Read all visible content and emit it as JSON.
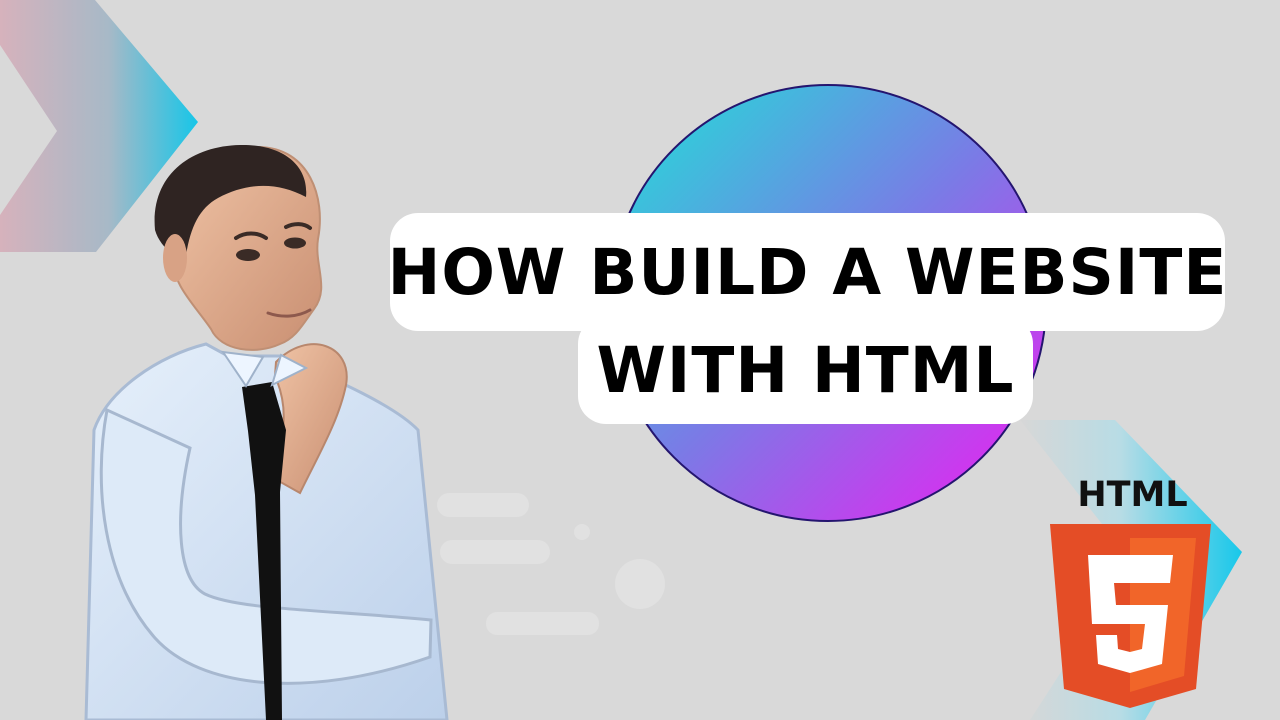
{
  "title": {
    "line1": "HOW BUILD A WEBSITE",
    "line2": "WITH HTML"
  },
  "logo": {
    "label": "HTML",
    "glyph": "5",
    "colors": {
      "outer": "#e44d26",
      "inner": "#f16529",
      "glyph": "#ffffff"
    }
  },
  "palette": {
    "background": "#d9d9d9",
    "circle_top": "#22e1d8",
    "circle_bottom": "#e11ef0",
    "arrow_start": "#d6a8b6",
    "arrow_end": "#18c8ea"
  },
  "decorations": {
    "person": "thinking-man-in-shirt-and-tie",
    "arrow_left": "chevron-arrow",
    "arrow_right": "chevron-arrow",
    "speed_lines": "faded-speed-lines"
  }
}
